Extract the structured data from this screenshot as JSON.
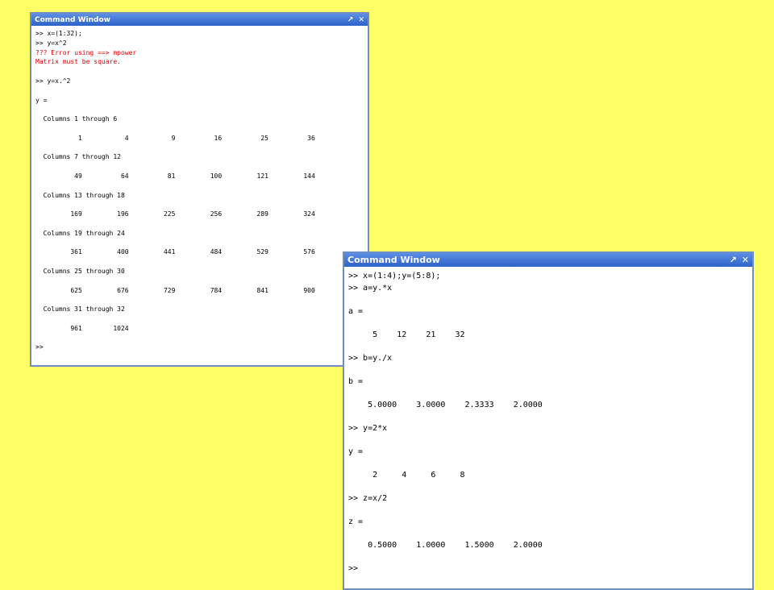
{
  "window1": {
    "title": "Command Window",
    "undock_icon": "↗",
    "close_icon": "✕",
    "lines": [
      {
        "text": ">> x=(1:32);",
        "type": "input"
      },
      {
        "text": ">> y=x^2",
        "type": "input"
      },
      {
        "text": "??? Error using ==> mpower",
        "type": "error"
      },
      {
        "text": "Matrix must be square.",
        "type": "error"
      },
      {
        "text": "",
        "type": "blank"
      },
      {
        "text": ">> y=x.^2",
        "type": "input"
      },
      {
        "text": "",
        "type": "blank"
      },
      {
        "text": "y =",
        "type": "output"
      },
      {
        "text": "",
        "type": "blank"
      },
      {
        "text": "  Columns 1 through 6",
        "type": "output"
      },
      {
        "text": "",
        "type": "blank"
      },
      {
        "text": "           1           4           9          16          25          36",
        "type": "output"
      },
      {
        "text": "",
        "type": "blank"
      },
      {
        "text": "  Columns 7 through 12",
        "type": "output"
      },
      {
        "text": "",
        "type": "blank"
      },
      {
        "text": "          49          64          81         100         121         144",
        "type": "output"
      },
      {
        "text": "",
        "type": "blank"
      },
      {
        "text": "  Columns 13 through 18",
        "type": "output"
      },
      {
        "text": "",
        "type": "blank"
      },
      {
        "text": "         169         196         225         256         289         324",
        "type": "output"
      },
      {
        "text": "",
        "type": "blank"
      },
      {
        "text": "  Columns 19 through 24",
        "type": "output"
      },
      {
        "text": "",
        "type": "blank"
      },
      {
        "text": "         361         400         441         484         529         576",
        "type": "output"
      },
      {
        "text": "",
        "type": "blank"
      },
      {
        "text": "  Columns 25 through 30",
        "type": "output"
      },
      {
        "text": "",
        "type": "blank"
      },
      {
        "text": "         625         676         729         784         841         900",
        "type": "output"
      },
      {
        "text": "",
        "type": "blank"
      },
      {
        "text": "  Columns 31 through 32",
        "type": "output"
      },
      {
        "text": "",
        "type": "blank"
      },
      {
        "text": "         961        1024",
        "type": "output"
      },
      {
        "text": "",
        "type": "blank"
      },
      {
        "text": ">>",
        "type": "prompt"
      }
    ]
  },
  "window2": {
    "title": "Command Window",
    "undock_icon": "↗",
    "close_icon": "✕",
    "lines": [
      {
        "text": ">> x=(1:4);y=(5:8);",
        "type": "input"
      },
      {
        "text": ">> a=y.*x",
        "type": "input"
      },
      {
        "text": "",
        "type": "blank"
      },
      {
        "text": "a =",
        "type": "output"
      },
      {
        "text": "",
        "type": "blank"
      },
      {
        "text": "     5    12    21    32",
        "type": "output"
      },
      {
        "text": "",
        "type": "blank"
      },
      {
        "text": ">> b=y./x",
        "type": "input"
      },
      {
        "text": "",
        "type": "blank"
      },
      {
        "text": "b =",
        "type": "output"
      },
      {
        "text": "",
        "type": "blank"
      },
      {
        "text": "    5.0000    3.0000    2.3333    2.0000",
        "type": "output"
      },
      {
        "text": "",
        "type": "blank"
      },
      {
        "text": ">> y=2*x",
        "type": "input"
      },
      {
        "text": "",
        "type": "blank"
      },
      {
        "text": "y =",
        "type": "output"
      },
      {
        "text": "",
        "type": "blank"
      },
      {
        "text": "     2     4     6     8",
        "type": "output"
      },
      {
        "text": "",
        "type": "blank"
      },
      {
        "text": ">> z=x/2",
        "type": "input"
      },
      {
        "text": "",
        "type": "blank"
      },
      {
        "text": "z =",
        "type": "output"
      },
      {
        "text": "",
        "type": "blank"
      },
      {
        "text": "    0.5000    1.0000    1.5000    2.0000",
        "type": "output"
      },
      {
        "text": "",
        "type": "blank"
      },
      {
        "text": ">>",
        "type": "prompt"
      }
    ]
  },
  "colors": {
    "background": "#ffff66",
    "titlebar": "#2d63c8",
    "error_text": "#e00000"
  }
}
